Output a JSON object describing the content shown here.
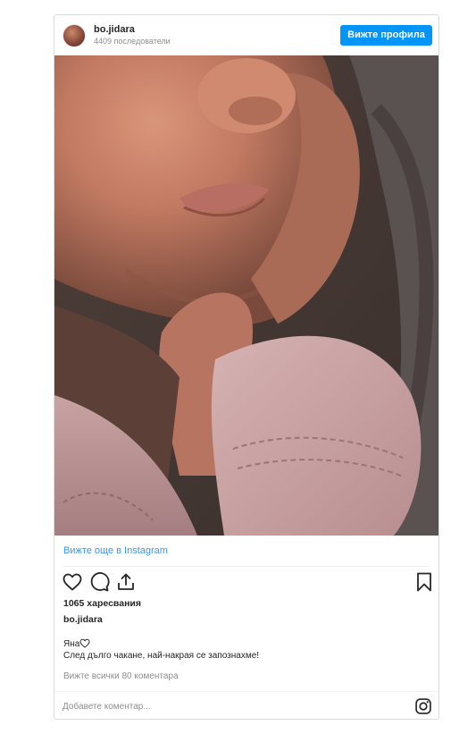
{
  "header": {
    "username": "bo.jidara",
    "followers": "4409 последователи",
    "view_profile_label": "Вижте профила"
  },
  "post": {
    "image_icon": "photo-newborn",
    "more_on_instagram": "Вижте още в Instagram",
    "icons": [
      "heart-icon",
      "comment-icon",
      "share-icon",
      "bookmark-icon"
    ],
    "likes": "1065 харесвания",
    "owner": "bo.jidara",
    "caption_line1": "Яна",
    "caption_line2": "След дълго чакане, най-накрая се запознахме!",
    "view_all_comments": "Вижте всички 80 коментара",
    "comment_placeholder": "Добавете коментар..."
  },
  "colors": {
    "accent": "#0095f6",
    "link": "#3897f0",
    "muted": "#8e8e8e",
    "text": "#262626",
    "border": "#dbdbdb"
  }
}
